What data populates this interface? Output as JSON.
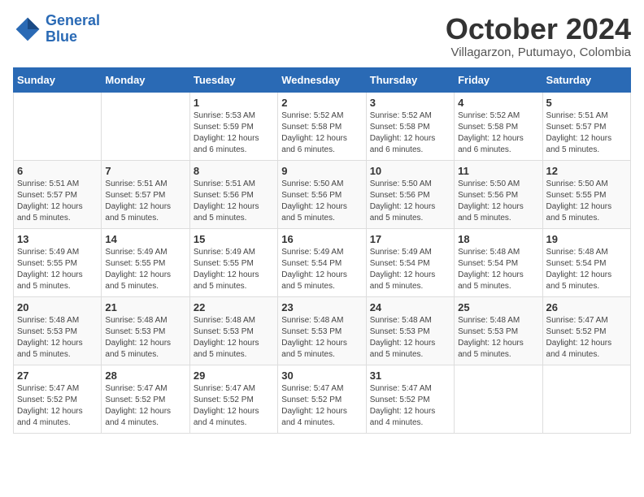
{
  "logo": {
    "line1": "General",
    "line2": "Blue"
  },
  "title": "October 2024",
  "subtitle": "Villagarzon, Putumayo, Colombia",
  "days_of_week": [
    "Sunday",
    "Monday",
    "Tuesday",
    "Wednesday",
    "Thursday",
    "Friday",
    "Saturday"
  ],
  "weeks": [
    [
      {
        "day": "",
        "info": ""
      },
      {
        "day": "",
        "info": ""
      },
      {
        "day": "1",
        "info": "Sunrise: 5:53 AM\nSunset: 5:59 PM\nDaylight: 12 hours and 6 minutes."
      },
      {
        "day": "2",
        "info": "Sunrise: 5:52 AM\nSunset: 5:58 PM\nDaylight: 12 hours and 6 minutes."
      },
      {
        "day": "3",
        "info": "Sunrise: 5:52 AM\nSunset: 5:58 PM\nDaylight: 12 hours and 6 minutes."
      },
      {
        "day": "4",
        "info": "Sunrise: 5:52 AM\nSunset: 5:58 PM\nDaylight: 12 hours and 6 minutes."
      },
      {
        "day": "5",
        "info": "Sunrise: 5:51 AM\nSunset: 5:57 PM\nDaylight: 12 hours and 5 minutes."
      }
    ],
    [
      {
        "day": "6",
        "info": "Sunrise: 5:51 AM\nSunset: 5:57 PM\nDaylight: 12 hours and 5 minutes."
      },
      {
        "day": "7",
        "info": "Sunrise: 5:51 AM\nSunset: 5:57 PM\nDaylight: 12 hours and 5 minutes."
      },
      {
        "day": "8",
        "info": "Sunrise: 5:51 AM\nSunset: 5:56 PM\nDaylight: 12 hours and 5 minutes."
      },
      {
        "day": "9",
        "info": "Sunrise: 5:50 AM\nSunset: 5:56 PM\nDaylight: 12 hours and 5 minutes."
      },
      {
        "day": "10",
        "info": "Sunrise: 5:50 AM\nSunset: 5:56 PM\nDaylight: 12 hours and 5 minutes."
      },
      {
        "day": "11",
        "info": "Sunrise: 5:50 AM\nSunset: 5:56 PM\nDaylight: 12 hours and 5 minutes."
      },
      {
        "day": "12",
        "info": "Sunrise: 5:50 AM\nSunset: 5:55 PM\nDaylight: 12 hours and 5 minutes."
      }
    ],
    [
      {
        "day": "13",
        "info": "Sunrise: 5:49 AM\nSunset: 5:55 PM\nDaylight: 12 hours and 5 minutes."
      },
      {
        "day": "14",
        "info": "Sunrise: 5:49 AM\nSunset: 5:55 PM\nDaylight: 12 hours and 5 minutes."
      },
      {
        "day": "15",
        "info": "Sunrise: 5:49 AM\nSunset: 5:55 PM\nDaylight: 12 hours and 5 minutes."
      },
      {
        "day": "16",
        "info": "Sunrise: 5:49 AM\nSunset: 5:54 PM\nDaylight: 12 hours and 5 minutes."
      },
      {
        "day": "17",
        "info": "Sunrise: 5:49 AM\nSunset: 5:54 PM\nDaylight: 12 hours and 5 minutes."
      },
      {
        "day": "18",
        "info": "Sunrise: 5:48 AM\nSunset: 5:54 PM\nDaylight: 12 hours and 5 minutes."
      },
      {
        "day": "19",
        "info": "Sunrise: 5:48 AM\nSunset: 5:54 PM\nDaylight: 12 hours and 5 minutes."
      }
    ],
    [
      {
        "day": "20",
        "info": "Sunrise: 5:48 AM\nSunset: 5:53 PM\nDaylight: 12 hours and 5 minutes."
      },
      {
        "day": "21",
        "info": "Sunrise: 5:48 AM\nSunset: 5:53 PM\nDaylight: 12 hours and 5 minutes."
      },
      {
        "day": "22",
        "info": "Sunrise: 5:48 AM\nSunset: 5:53 PM\nDaylight: 12 hours and 5 minutes."
      },
      {
        "day": "23",
        "info": "Sunrise: 5:48 AM\nSunset: 5:53 PM\nDaylight: 12 hours and 5 minutes."
      },
      {
        "day": "24",
        "info": "Sunrise: 5:48 AM\nSunset: 5:53 PM\nDaylight: 12 hours and 5 minutes."
      },
      {
        "day": "25",
        "info": "Sunrise: 5:48 AM\nSunset: 5:53 PM\nDaylight: 12 hours and 5 minutes."
      },
      {
        "day": "26",
        "info": "Sunrise: 5:47 AM\nSunset: 5:52 PM\nDaylight: 12 hours and 4 minutes."
      }
    ],
    [
      {
        "day": "27",
        "info": "Sunrise: 5:47 AM\nSunset: 5:52 PM\nDaylight: 12 hours and 4 minutes."
      },
      {
        "day": "28",
        "info": "Sunrise: 5:47 AM\nSunset: 5:52 PM\nDaylight: 12 hours and 4 minutes."
      },
      {
        "day": "29",
        "info": "Sunrise: 5:47 AM\nSunset: 5:52 PM\nDaylight: 12 hours and 4 minutes."
      },
      {
        "day": "30",
        "info": "Sunrise: 5:47 AM\nSunset: 5:52 PM\nDaylight: 12 hours and 4 minutes."
      },
      {
        "day": "31",
        "info": "Sunrise: 5:47 AM\nSunset: 5:52 PM\nDaylight: 12 hours and 4 minutes."
      },
      {
        "day": "",
        "info": ""
      },
      {
        "day": "",
        "info": ""
      }
    ]
  ]
}
